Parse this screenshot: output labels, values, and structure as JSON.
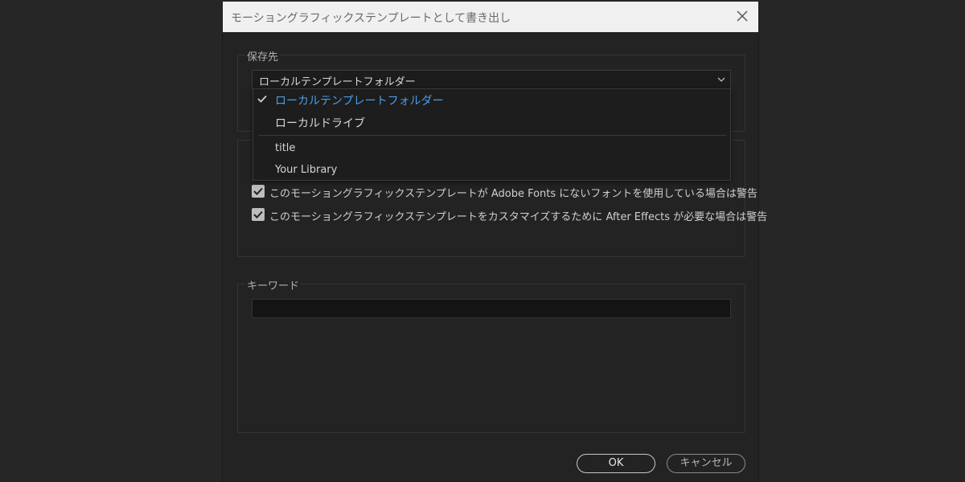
{
  "dialog": {
    "title": "モーショングラフィックステンプレートとして書き出し"
  },
  "destination": {
    "group_label": "保存先",
    "selected_value": "ローカルテンプレートフォルダー",
    "options": [
      {
        "label": "ローカルテンプレートフォルダー",
        "selected": true
      },
      {
        "label": "ローカルドライブ",
        "selected": false
      },
      {
        "label": "title",
        "selected": false
      },
      {
        "label": "Your Library",
        "selected": false
      }
    ]
  },
  "compatibility": {
    "checkboxes": [
      {
        "label": "このモーショングラフィックステンプレートが Adobe Fonts にないフォントを使用している場合は警告",
        "checked": true
      },
      {
        "label": "このモーショングラフィックステンプレートをカスタマイズするために After Effects が必要な場合は警告",
        "checked": true
      }
    ]
  },
  "keywords": {
    "group_label": "キーワード",
    "value": ""
  },
  "buttons": {
    "ok": "OK",
    "cancel": "キャンセル"
  },
  "colors": {
    "accent": "#4a9ee8",
    "dialog_bg": "#232323",
    "titlebar_bg": "#f0f0f0"
  }
}
